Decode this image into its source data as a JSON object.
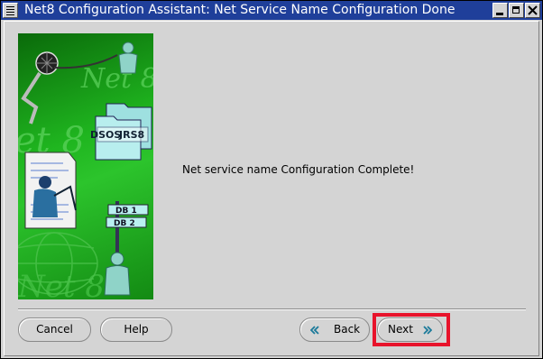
{
  "window": {
    "title": "Net8 Configuration Assistant: Net Service Name Configuration Done"
  },
  "content": {
    "message": "Net service name Configuration Complete!"
  },
  "art": {
    "net8_label": "Net 8",
    "net8_label_mid": "et 8",
    "net8_label_bottom": "Net 8",
    "folder_text_a": "DSOS",
    "folder_text_b": "JRS8",
    "db1_label": "DB 1",
    "db2_label": "DB 2"
  },
  "buttons": {
    "cancel": "Cancel",
    "help": "Help",
    "back": "Back",
    "next": "Next"
  },
  "colors": {
    "titlebar": "#1f3f9a",
    "highlight": "#e8132b",
    "art_green": "#22b422"
  },
  "icons": {
    "back": "chevron-left-icon",
    "next": "chevron-right-icon"
  }
}
